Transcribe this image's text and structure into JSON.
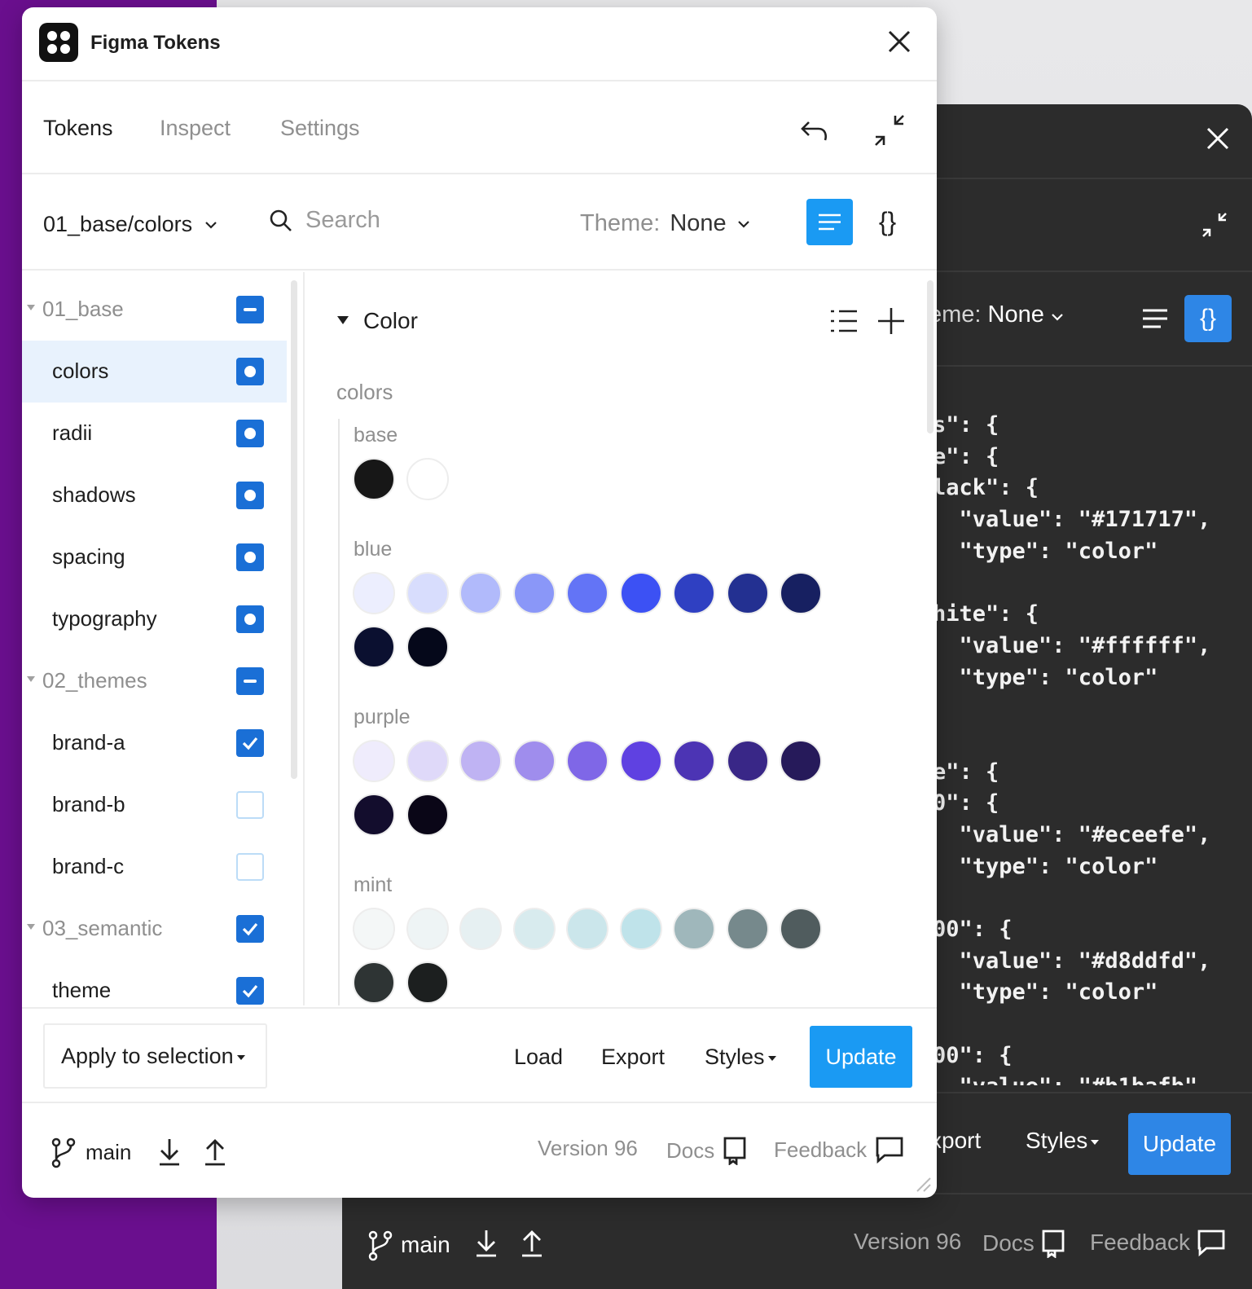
{
  "app": {
    "title": "Figma Tokens"
  },
  "tabs": [
    {
      "label": "Tokens",
      "active": true
    },
    {
      "label": "Inspect",
      "active": false
    },
    {
      "label": "Settings",
      "active": false
    }
  ],
  "toolbar": {
    "token_set": "01_base/colors",
    "search_placeholder": "Search",
    "theme_label": "Theme:",
    "theme_value": "None"
  },
  "sidebar": {
    "items": [
      {
        "label": "01_base",
        "group": true,
        "state": "minus"
      },
      {
        "label": "colors",
        "group": false,
        "state": "dot",
        "selected": true
      },
      {
        "label": "radii",
        "group": false,
        "state": "dot"
      },
      {
        "label": "shadows",
        "group": false,
        "state": "dot"
      },
      {
        "label": "spacing",
        "group": false,
        "state": "dot"
      },
      {
        "label": "typography",
        "group": false,
        "state": "dot"
      },
      {
        "label": "02_themes",
        "group": true,
        "state": "minus"
      },
      {
        "label": "brand-a",
        "group": false,
        "state": "check"
      },
      {
        "label": "brand-b",
        "group": false,
        "state": "empty"
      },
      {
        "label": "brand-c",
        "group": false,
        "state": "empty"
      },
      {
        "label": "03_semantic",
        "group": true,
        "state": "check"
      },
      {
        "label": "theme",
        "group": false,
        "state": "check"
      }
    ]
  },
  "main": {
    "section_title": "Color",
    "group_title": "colors",
    "subgroups": [
      {
        "label": "base",
        "colors": [
          "#171717",
          "#ffffff"
        ]
      },
      {
        "label": "blue",
        "colors": [
          "#eceefe",
          "#d8ddfd",
          "#b1bafb",
          "#8a97f8",
          "#6374f6",
          "#3c51f4",
          "#2f40c2",
          "#233091",
          "#172061",
          "#0b1030",
          "#05081a"
        ]
      },
      {
        "label": "purple",
        "colors": [
          "#efecfc",
          "#dfd9f9",
          "#bfb3f3",
          "#9f8ded",
          "#7f67e7",
          "#5f41e1",
          "#4c34b4",
          "#392787",
          "#261a5a",
          "#130d2d",
          "#0a0617"
        ]
      },
      {
        "label": "mint",
        "colors": [
          "#f4f7f7",
          "#eef4f5",
          "#e6f0f2",
          "#d8ebee",
          "#cbe6eb",
          "#bfe3ea",
          "#9fb7bb",
          "#76898c",
          "#505c5e",
          "#2e3434",
          "#1c1f1f"
        ]
      }
    ]
  },
  "actions": {
    "apply": "Apply to selection",
    "load": "Load",
    "export": "Export",
    "styles": "Styles",
    "update": "Update"
  },
  "footer": {
    "branch": "main",
    "version": "Version 96",
    "docs": "Docs",
    "feedback": "Feedback"
  },
  "dark_window": {
    "theme_label": "eme:",
    "theme_value": "None",
    "json_lines": [
      "s\": {",
      "e\": {",
      "lack\": {",
      "  \"value\": \"#171717\",",
      "  \"type\": \"color\"",
      "",
      "hite\": {",
      "  \"value\": \"#ffffff\",",
      "  \"type\": \"color\"",
      "",
      "",
      "e\": {",
      "0\": {",
      "  \"value\": \"#eceefe\",",
      "  \"type\": \"color\"",
      "",
      "00\": {",
      "  \"value\": \"#d8ddfd\",",
      "  \"type\": \"color\"",
      "",
      "00\": {",
      "  \"value\": \"#b1bafb\","
    ],
    "export": "xport",
    "styles": "Styles",
    "update": "Update",
    "branch": "main",
    "version": "Version 96",
    "docs": "Docs",
    "feedback": "Feedback"
  },
  "colors": {
    "accent": "#1a9af3",
    "checkbox": "#1a6fd6",
    "dark_accent": "#2e86e6",
    "background_left": "#6a0f8e"
  }
}
